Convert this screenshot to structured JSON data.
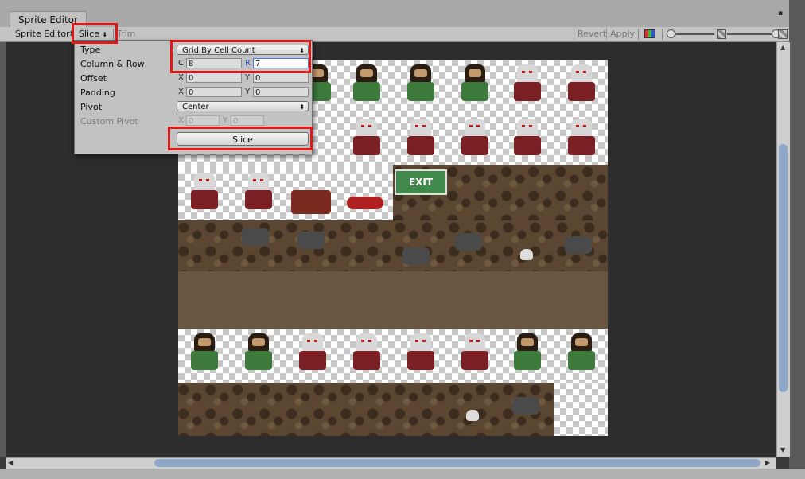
{
  "window": {
    "tab_label": "Sprite Editor",
    "controls": {
      "menu": "▪",
      "close": "✕"
    }
  },
  "toolbar": {
    "editor_menu_label": "Sprite Editor",
    "slice_label": "Slice",
    "trim_label": "Trim",
    "revert_label": "Revert",
    "apply_label": "Apply",
    "icons": [
      "rgb-channel-icon",
      "zoom-slider",
      "alpha-icon",
      "mip-slider"
    ]
  },
  "slice_panel": {
    "type_label": "Type",
    "type_value": "Grid By Cell Count",
    "column_row_label": "Column & Row",
    "column_prefix": "C",
    "column_value": "8",
    "row_prefix": "R",
    "row_value": "7",
    "offset_label": "Offset",
    "offset_x_prefix": "X",
    "offset_x": "0",
    "offset_y_prefix": "Y",
    "offset_y": "0",
    "padding_label": "Padding",
    "padding_x_prefix": "X",
    "padding_x": "0",
    "padding_y_prefix": "Y",
    "padding_y": "0",
    "pivot_label": "Pivot",
    "pivot_value": "Center",
    "custom_pivot_label": "Custom Pivot",
    "custom_x_prefix": "X",
    "custom_x": "0",
    "custom_y_prefix": "Y",
    "custom_y": "0",
    "slice_button_label": "Slice"
  },
  "sprite_sheet": {
    "exit_sign_text": "EXIT",
    "highlight_color": "#e01818"
  }
}
